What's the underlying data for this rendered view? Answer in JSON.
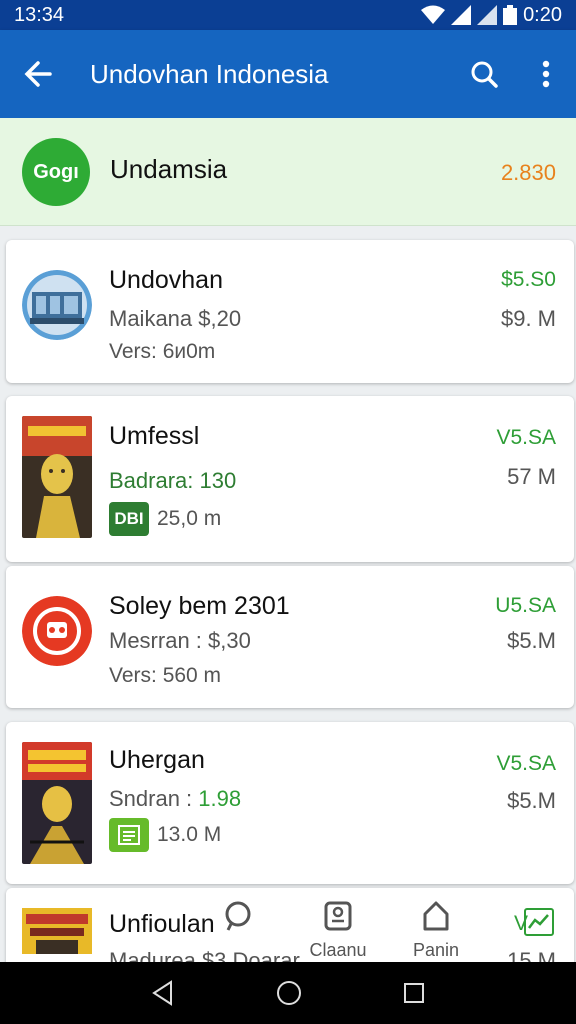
{
  "status_bar": {
    "time": "13:34",
    "clock_right": "0:20"
  },
  "app_bar": {
    "title": "Undovhan Indonesia"
  },
  "featured": {
    "logo_text": "Gogı",
    "name": "Undamsia",
    "value": "2.830",
    "value_color": "#e8821d"
  },
  "items": [
    {
      "name": "Undovhan",
      "line2": "Maikana $,20",
      "line3": "Vers: 6и0m",
      "price": "$5.S0",
      "size": "$9. M"
    },
    {
      "name": "Umfessl",
      "line2": "Badrara: 130",
      "badge": "DBI",
      "line3": "25,0 m",
      "price": "V5.SA",
      "size": "57 M"
    },
    {
      "name": "Soley bem 2301",
      "line2": "Mesrran : $,30",
      "line3": "Vers: 560 m",
      "price": "U5.SA",
      "size": "$5.M"
    },
    {
      "name": "Uhergan",
      "line2_label": "Sndran :",
      "line2_value": "1.98",
      "line3": "13.0 M",
      "price": "V5.SA",
      "size": "$5.M"
    },
    {
      "name": "Unfioulan",
      "line2": "Madurea $3 Doarar",
      "price": "V",
      "size": "15 M"
    }
  ],
  "bottom_nav": {
    "item2_label": "Claanu",
    "item3_label": "Panin"
  },
  "colors": {
    "app_bar": "#1565c0",
    "status_bar": "#0b3f94",
    "accent_green": "#2e9e36",
    "featured_bg": "#e6f7e2"
  }
}
